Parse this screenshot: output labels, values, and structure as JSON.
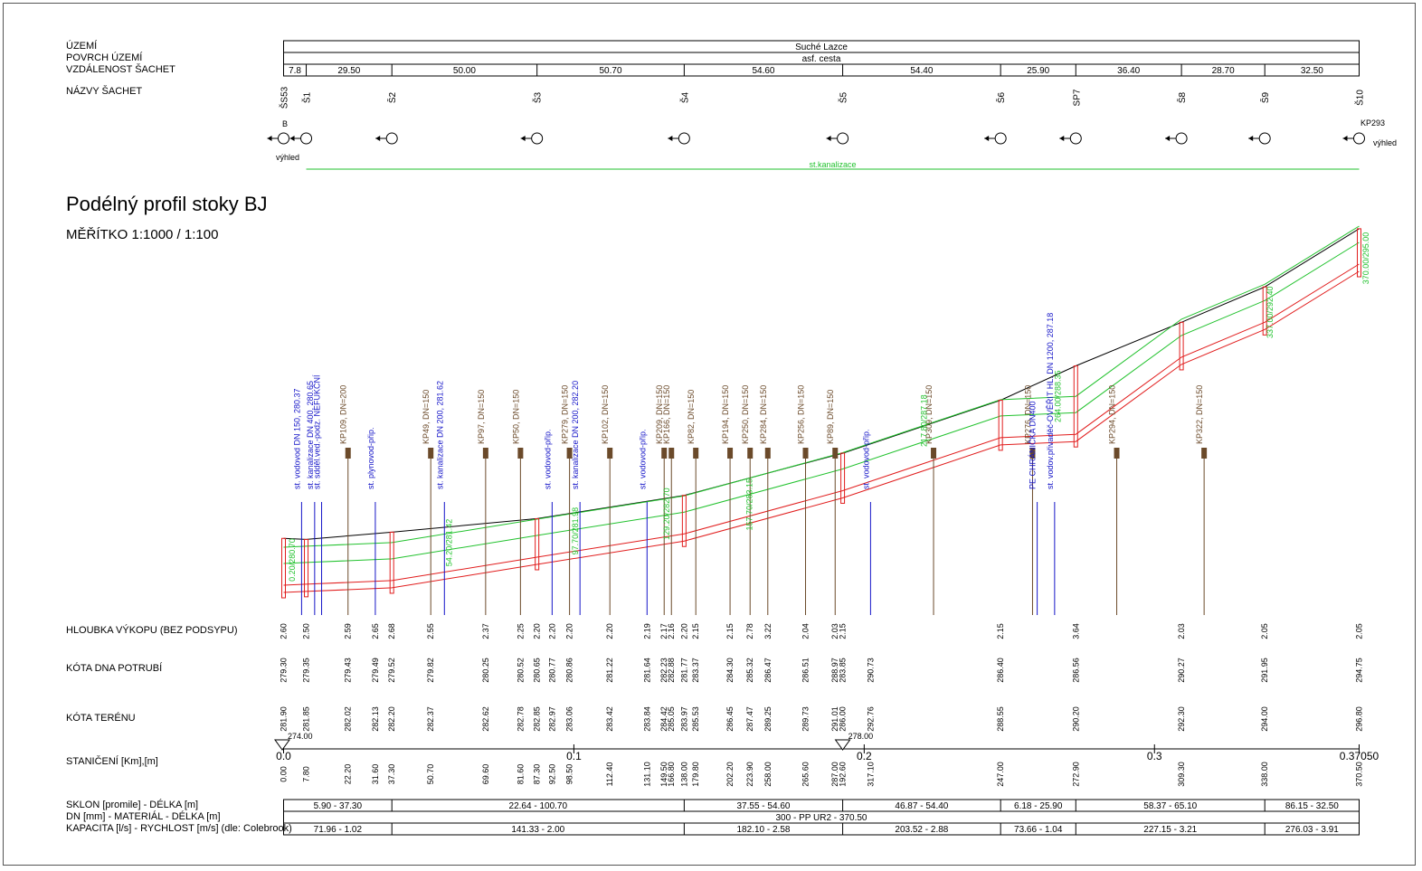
{
  "header": {
    "territory_label": "ÚZEMÍ",
    "surface_label": "POVRCH ÚZEMÍ",
    "distance_label": "VZDÁLENOST ŠACHET",
    "manholes_label": "NÁZVY ŠACHET",
    "territory_value": "Suché Lazce",
    "surface_value": "asf. cesta"
  },
  "drawing": {
    "title": "Podélný profil stoky BJ",
    "scale": "MĚŘÍTKO 1:1000 / 1:100",
    "view_left": "výhled",
    "view_right": "výhled",
    "start_marker": "B",
    "end_marker": "KP293",
    "sewer_label": "st.kanalizace",
    "datum_left": "274.00",
    "datum_right": "278.00"
  },
  "rows": {
    "depth_label": "HLOUBKA VÝKOPU (BEZ PODSYPU)",
    "invert_label": "KÓTA DNA POTRUBÍ",
    "terrain_label": "KÓTA TERÉNU",
    "station_label": "STANIČENÍ [Km],[m]",
    "slope_label": "SKLON [promile] - DÉLKA [m]",
    "dn_label": "DN [mm] - MATERIÁL - DÉLKA [m]",
    "capacity_label": "KAPACITA [l/s] - RYCHLOST [m/s] (dle: Colebrook)"
  },
  "chart_data": {
    "type": "line",
    "distances": [
      "7.8",
      "29.50",
      "50.00",
      "50.70",
      "54.60",
      "54.40",
      "25.90",
      "36.40",
      "28.70",
      "32.50"
    ],
    "manholes": [
      {
        "name": "ŠS53",
        "station": 0.0,
        "depth": "2.60",
        "invert": "279.30",
        "terrain": "281.90"
      },
      {
        "name": "Š1",
        "station": 7.8,
        "depth": "2.50",
        "invert": "279.35",
        "terrain": "281.85"
      },
      {
        "name": "Š2",
        "station": 37.3,
        "depth": "2.68",
        "invert": "279.52",
        "terrain": "282.20"
      },
      {
        "name": "Š3",
        "station": 87.3,
        "depth": "2.20",
        "invert": "280.65",
        "terrain": "282.85"
      },
      {
        "name": "Š4",
        "station": 138.0,
        "depth": "2.20",
        "invert": "281.77",
        "terrain": "283.97"
      },
      {
        "name": "Š5",
        "station": 192.6,
        "depth": "2.15",
        "invert": "283.85",
        "terrain": "286.00"
      },
      {
        "name": "Š6",
        "station": 247.0,
        "depth": "2.15",
        "invert": "286.40",
        "terrain": "288.55"
      },
      {
        "name": "SP7",
        "station": 272.9,
        "depth": "3.64",
        "invert": "286.56",
        "terrain": "290.20"
      },
      {
        "name": "Š8",
        "station": 309.3,
        "depth": "2.03",
        "invert": "290.27",
        "terrain": "292.30"
      },
      {
        "name": "Š9",
        "station": 338.0,
        "depth": "2.05",
        "invert": "291.95",
        "terrain": "294.00"
      },
      {
        "name": "Š10",
        "station": 370.5,
        "depth": "2.05",
        "invert": "294.75",
        "terrain": "296.80"
      }
    ],
    "crossings": [
      {
        "label": "st. vodovod DN 150, 280.37",
        "station": 6.2
      },
      {
        "label": "st. kanalizace DN 400, 280.65",
        "station": 10.7
      },
      {
        "label": "st. sdděl.ved.-podz. NEFUKČNÍ",
        "station": 13.1
      },
      {
        "label": "KP109, DN=200",
        "station": 22.2
      },
      {
        "label": "st. plynovod-přip.",
        "station": 31.6
      },
      {
        "label": "KP49, DN=150",
        "station": 50.7
      },
      {
        "label": "st. kanalizace DN 200, 281.62",
        "station": 55.4
      },
      {
        "label": "KP97, DN=150",
        "station": 69.6
      },
      {
        "label": "KP50, DN=150",
        "station": 81.6
      },
      {
        "label": "st. vodovod-přip.",
        "station": 92.5
      },
      {
        "label": "KP279, DN=150",
        "station": 98.5
      },
      {
        "label": "st. kanalizace DN 200, 282.20",
        "station": 102.1
      },
      {
        "label": "KP102, DN=150",
        "station": 112.4
      },
      {
        "label": "st. vodovod-přip.",
        "station": 125.2
      },
      {
        "label": "KP209, DN=150",
        "station": 131.1
      },
      {
        "label": "KP166, DN=150",
        "station": 133.6
      },
      {
        "label": "KP82, DN=150",
        "station": 142.0
      },
      {
        "label": "KP194, DN=150",
        "station": 153.8
      },
      {
        "label": "KP250, DN=150",
        "station": 160.7
      },
      {
        "label": "KP284, DN=150",
        "station": 166.8
      },
      {
        "label": "KP256, DN=150",
        "station": 179.8
      },
      {
        "label": "KP89, DN=150",
        "station": 190.0
      },
      {
        "label": "st. vodovod-přip.",
        "station": 202.2
      },
      {
        "label": "KP309, DN=150",
        "station": 223.9
      },
      {
        "label": "KP276, DN=150",
        "station": 258.0
      },
      {
        "label": "PE CHRÁNIČKA DN400",
        "station": 259.6
      },
      {
        "label": "st. vodov.přivaděč-OVĚŘIT HL. DN 1200, 287.18",
        "station": 265.6
      },
      {
        "label": "KP294, DN=150",
        "station": 287.0
      },
      {
        "label": "KP322, DN=150",
        "station": 317.1
      }
    ],
    "crossing_depths": [
      "2.59",
      "2.65",
      "2.55",
      "2.37",
      "2.25",
      "2.20",
      "2.20",
      "2.20",
      "2.19",
      "2.17",
      "2.16",
      "2.15",
      "2.15",
      "2.78",
      "3.22",
      "2.04",
      "2.03"
    ],
    "crossing_inverts": [
      "279.43",
      "279.49",
      "279.82",
      "280.25",
      "280.52",
      "280.77",
      "280.86",
      "281.22",
      "281.64",
      "282.23",
      "282.88",
      "283.37",
      "284.30",
      "285.32",
      "286.47",
      "286.51",
      "288.97",
      "290.73"
    ],
    "crossing_terrains": [
      "282.02",
      "282.13",
      "282.37",
      "282.62",
      "282.78",
      "282.97",
      "283.06",
      "283.42",
      "283.84",
      "284.42",
      "285.05",
      "285.53",
      "286.45",
      "287.47",
      "289.25",
      "289.73",
      "291.01",
      "292.76"
    ],
    "crossing_stations": [
      "22.20",
      "31.60",
      "50.70",
      "69.60",
      "81.60",
      "92.50",
      "98.50",
      "112.40",
      "131.10",
      "149.50",
      "166.80",
      "179.80",
      "202.20",
      "223.90",
      "258.00",
      "265.60",
      "287.00",
      "317.10"
    ],
    "pipe_labels": [
      "0.20/280.70",
      "54.20/281.42",
      "97.70/281.98",
      "129.20/282.70",
      "157.70/283.15",
      "217.80/287.18",
      "264.00/288.35",
      "337.00/292.40",
      "370.00/295.00"
    ],
    "chainage_ticks": [
      "0.0",
      "0.1",
      "0.2",
      "0.3",
      "0.37050"
    ],
    "segments": [
      {
        "slope": "5.90 - 37.30",
        "capacity": "71.96 - 1.02"
      },
      {
        "slope": "22.64 - 100.70",
        "capacity": "141.33 - 2.00"
      },
      {
        "slope": "37.55 - 54.60",
        "capacity": "182.10 - 2.58"
      },
      {
        "slope": "46.87 - 54.40",
        "capacity": "203.52 - 2.88"
      },
      {
        "slope": "6.18 - 25.90",
        "capacity": "73.66 - 1.04"
      },
      {
        "slope": "58.37 - 65.10",
        "capacity": "227.15 - 3.21"
      },
      {
        "slope": "86.15 - 32.50",
        "capacity": "276.03 - 3.91"
      }
    ],
    "dn_material": "300 - PP UR2 - 370.50",
    "colors": {
      "terrain": "#000000",
      "pipe": "#e11d1d",
      "design": "#22c22e",
      "utility": "#1515c8",
      "note": "#6b4a2a"
    }
  }
}
